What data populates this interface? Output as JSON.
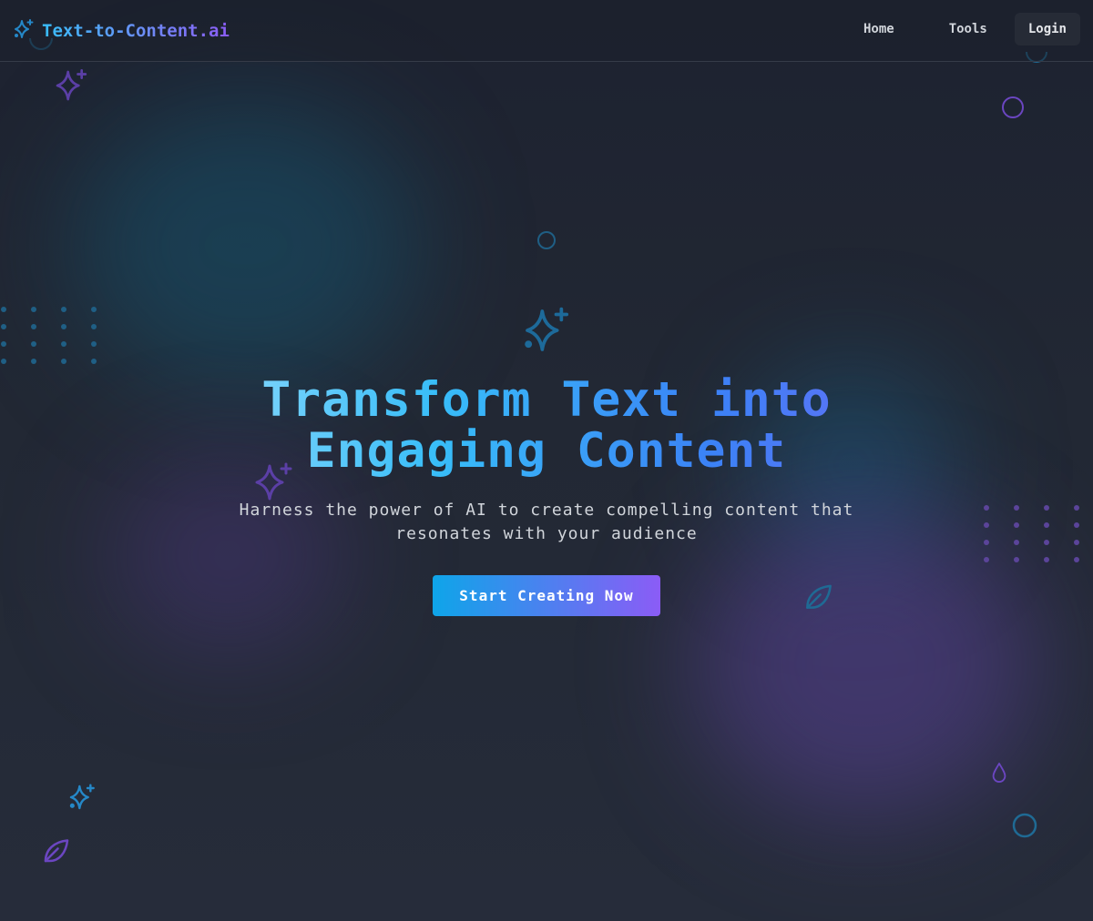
{
  "navbar": {
    "logo_text": "Text-to-Content.ai",
    "logo_icon": "sparkles-icon",
    "links": [
      {
        "label": "Home"
      },
      {
        "label": "Tools"
      },
      {
        "label": "Login"
      }
    ]
  },
  "hero": {
    "icon": "sparkles-icon",
    "title_line1": "Transform Text into",
    "title_line2": "Engaging Content",
    "subtitle": "Harness the power of AI to create compelling content that resonates with your audience",
    "cta_label": "Start Creating Now"
  },
  "decorations": {
    "icons": [
      "sparkles-icon",
      "circle-icon",
      "leaf-icon",
      "droplet-icon"
    ]
  },
  "colors": {
    "accent_blue": "#0ea5e9",
    "accent_purple": "#8b5cf6",
    "background": "#1f2430"
  }
}
